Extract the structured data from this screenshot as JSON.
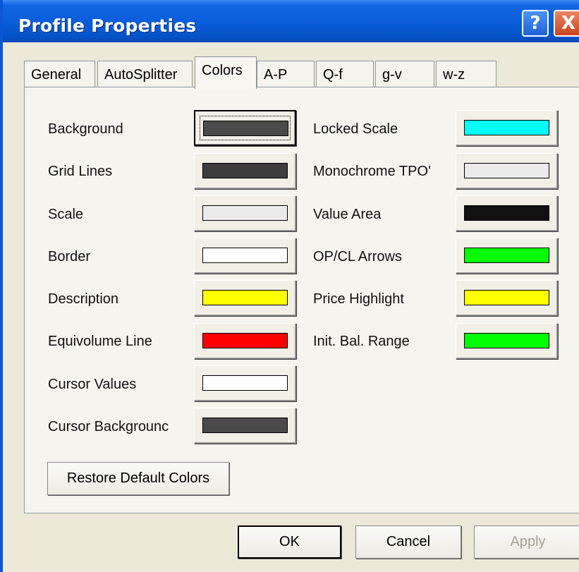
{
  "window": {
    "title": "Profile Properties",
    "help_label": "?",
    "close_label": "X"
  },
  "tabs": [
    {
      "label": "General"
    },
    {
      "label": "AutoSplitter"
    },
    {
      "label": "Colors",
      "active": true
    },
    {
      "label": "A-P"
    },
    {
      "label": "Q-f"
    },
    {
      "label": "g-v"
    },
    {
      "label": "w-z"
    }
  ],
  "colors": {
    "left": [
      {
        "label": "Background",
        "color": "#4a4a4a"
      },
      {
        "label": "Grid Lines",
        "color": "#3d3d3d"
      },
      {
        "label": "Scale",
        "color": "#ebebeb"
      },
      {
        "label": "Border",
        "color": "#ffffff"
      },
      {
        "label": "Description",
        "color": "#ffff00"
      },
      {
        "label": "Equivolume Line",
        "color": "#ff0000"
      },
      {
        "label": "Cursor Values",
        "color": "#ffffff"
      },
      {
        "label": "Cursor Backgrounc",
        "color": "#4a4a4a"
      }
    ],
    "right": [
      {
        "label": "Locked Scale",
        "color": "#00ffff"
      },
      {
        "label": "Monochrome TPO'",
        "color": "#ebebeb"
      },
      {
        "label": "Value Area",
        "color": "#111111"
      },
      {
        "label": "OP/CL Arrows",
        "color": "#00ff00"
      },
      {
        "label": "Price Highlight",
        "color": "#ffff00"
      },
      {
        "label": "Init. Bal. Range",
        "color": "#00ff00"
      }
    ]
  },
  "restore_label": "Restore Default Colors",
  "buttons": {
    "ok": "OK",
    "cancel": "Cancel",
    "apply": "Apply"
  }
}
